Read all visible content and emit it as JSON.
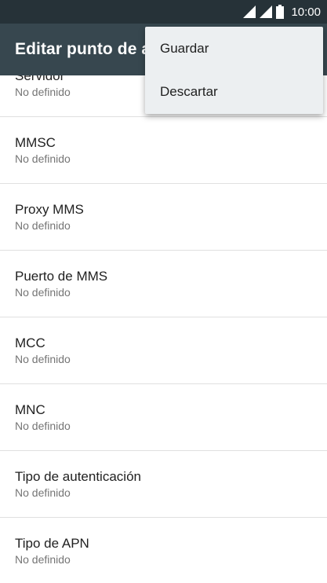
{
  "status_bar": {
    "time": "10:00"
  },
  "app_bar": {
    "title": "Editar punto de acceso"
  },
  "menu": {
    "items": [
      {
        "label": "Guardar"
      },
      {
        "label": "Descartar"
      }
    ]
  },
  "settings": [
    {
      "title": "Servidor",
      "value": "No definido"
    },
    {
      "title": "MMSC",
      "value": "No definido"
    },
    {
      "title": "Proxy MMS",
      "value": "No definido"
    },
    {
      "title": "Puerto de MMS",
      "value": "No definido"
    },
    {
      "title": "MCC",
      "value": "No definido"
    },
    {
      "title": "MNC",
      "value": "No definido"
    },
    {
      "title": "Tipo de autenticación",
      "value": "No definido"
    },
    {
      "title": "Tipo de APN",
      "value": "No definido"
    }
  ]
}
